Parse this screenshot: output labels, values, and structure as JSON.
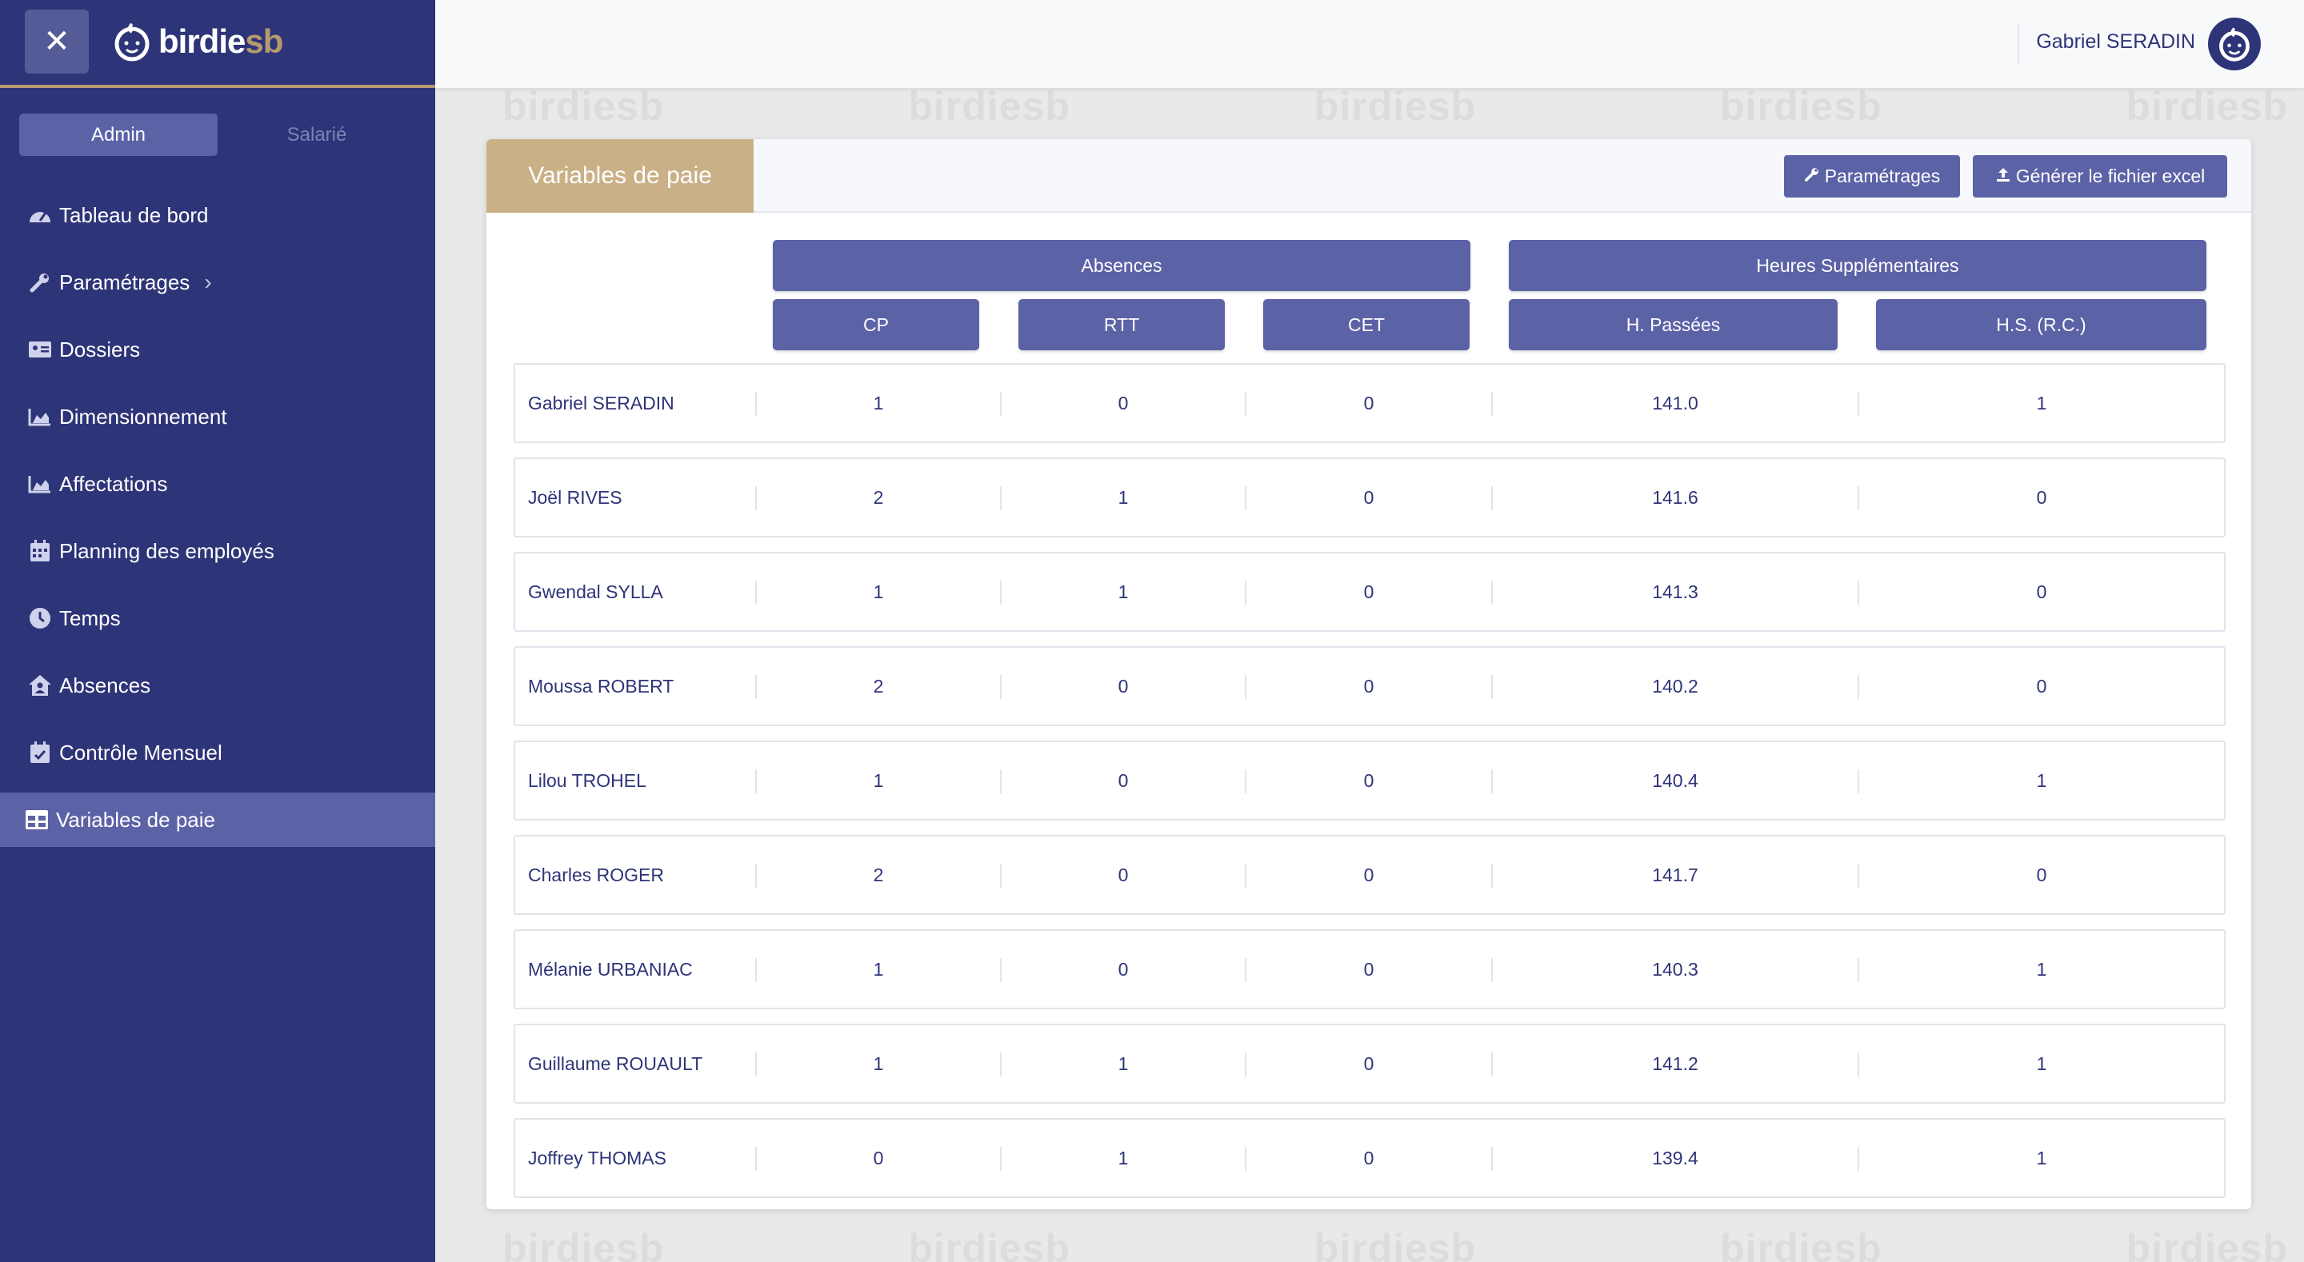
{
  "brand": {
    "part1": "birdie",
    "part2": "sb"
  },
  "sidebar": {
    "roles": [
      {
        "label": "Admin",
        "active": true
      },
      {
        "label": "Salarié",
        "active": false
      }
    ],
    "items": [
      {
        "label": "Tableau de bord",
        "icon": "dashboard-icon"
      },
      {
        "label": "Paramétrages",
        "icon": "wrench-icon",
        "has_submenu": true
      },
      {
        "label": "Dossiers",
        "icon": "id-card-icon"
      },
      {
        "label": "Dimensionnement",
        "icon": "area-chart-icon"
      },
      {
        "label": "Affectations",
        "icon": "area-chart-icon"
      },
      {
        "label": "Planning des employés",
        "icon": "calendar-icon"
      },
      {
        "label": "Temps",
        "icon": "clock-icon"
      },
      {
        "label": "Absences",
        "icon": "house-user-icon"
      },
      {
        "label": "Contrôle Mensuel",
        "icon": "calendar-check-icon"
      },
      {
        "label": "Variables de paie",
        "icon": "table-icon",
        "active": true
      }
    ]
  },
  "header": {
    "user_name": "Gabriel SERADIN"
  },
  "watermark": "birdiesb",
  "card": {
    "title": "Variables de paie",
    "settings_button": "Paramétrages",
    "export_button": "Générer le fichier excel"
  },
  "table": {
    "group_headers": {
      "absences": "Absences",
      "overtime": "Heures Supplémentaires"
    },
    "columns": [
      "CP",
      "RTT",
      "CET",
      "H. Passées",
      "H.S. (R.C.)"
    ],
    "rows": [
      {
        "name": "Gabriel SERADIN",
        "cp": "1",
        "rtt": "0",
        "cet": "0",
        "h_passees": "141.0",
        "hs_rc": "1"
      },
      {
        "name": "Joël RIVES",
        "cp": "2",
        "rtt": "1",
        "cet": "0",
        "h_passees": "141.6",
        "hs_rc": "0"
      },
      {
        "name": "Gwendal SYLLA",
        "cp": "1",
        "rtt": "1",
        "cet": "0",
        "h_passees": "141.3",
        "hs_rc": "0"
      },
      {
        "name": "Moussa ROBERT",
        "cp": "2",
        "rtt": "0",
        "cet": "0",
        "h_passees": "140.2",
        "hs_rc": "0"
      },
      {
        "name": "Lilou TROHEL",
        "cp": "1",
        "rtt": "0",
        "cet": "0",
        "h_passees": "140.4",
        "hs_rc": "1"
      },
      {
        "name": "Charles ROGER",
        "cp": "2",
        "rtt": "0",
        "cet": "0",
        "h_passees": "141.7",
        "hs_rc": "0"
      },
      {
        "name": "Mélanie URBANIAC",
        "cp": "1",
        "rtt": "0",
        "cet": "0",
        "h_passees": "140.3",
        "hs_rc": "1"
      },
      {
        "name": "Guillaume ROUAULT",
        "cp": "1",
        "rtt": "1",
        "cet": "0",
        "h_passees": "141.2",
        "hs_rc": "1"
      },
      {
        "name": "Joffrey THOMAS",
        "cp": "0",
        "rtt": "1",
        "cet": "0",
        "h_passees": "139.4",
        "hs_rc": "1"
      }
    ]
  },
  "colors": {
    "sidebar_bg": "#2e3478",
    "accent": "#5c62a6",
    "gold": "#c9b087",
    "text": "#2e3478"
  }
}
